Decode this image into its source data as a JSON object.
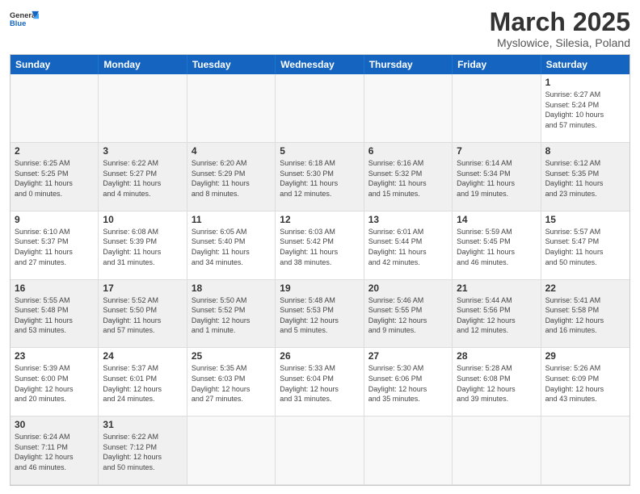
{
  "logo": {
    "text_general": "General",
    "text_blue": "Blue"
  },
  "title": "March 2025",
  "location": "Myslowice, Silesia, Poland",
  "days_of_week": [
    "Sunday",
    "Monday",
    "Tuesday",
    "Wednesday",
    "Thursday",
    "Friday",
    "Saturday"
  ],
  "weeks": [
    [
      {
        "day": "",
        "info": ""
      },
      {
        "day": "",
        "info": ""
      },
      {
        "day": "",
        "info": ""
      },
      {
        "day": "",
        "info": ""
      },
      {
        "day": "",
        "info": ""
      },
      {
        "day": "",
        "info": ""
      },
      {
        "day": "1",
        "info": "Sunrise: 6:27 AM\nSunset: 5:24 PM\nDaylight: 10 hours\nand 57 minutes."
      }
    ],
    [
      {
        "day": "2",
        "info": "Sunrise: 6:25 AM\nSunset: 5:25 PM\nDaylight: 11 hours\nand 0 minutes."
      },
      {
        "day": "3",
        "info": "Sunrise: 6:22 AM\nSunset: 5:27 PM\nDaylight: 11 hours\nand 4 minutes."
      },
      {
        "day": "4",
        "info": "Sunrise: 6:20 AM\nSunset: 5:29 PM\nDaylight: 11 hours\nand 8 minutes."
      },
      {
        "day": "5",
        "info": "Sunrise: 6:18 AM\nSunset: 5:30 PM\nDaylight: 11 hours\nand 12 minutes."
      },
      {
        "day": "6",
        "info": "Sunrise: 6:16 AM\nSunset: 5:32 PM\nDaylight: 11 hours\nand 15 minutes."
      },
      {
        "day": "7",
        "info": "Sunrise: 6:14 AM\nSunset: 5:34 PM\nDaylight: 11 hours\nand 19 minutes."
      },
      {
        "day": "8",
        "info": "Sunrise: 6:12 AM\nSunset: 5:35 PM\nDaylight: 11 hours\nand 23 minutes."
      }
    ],
    [
      {
        "day": "9",
        "info": "Sunrise: 6:10 AM\nSunset: 5:37 PM\nDaylight: 11 hours\nand 27 minutes."
      },
      {
        "day": "10",
        "info": "Sunrise: 6:08 AM\nSunset: 5:39 PM\nDaylight: 11 hours\nand 31 minutes."
      },
      {
        "day": "11",
        "info": "Sunrise: 6:05 AM\nSunset: 5:40 PM\nDaylight: 11 hours\nand 34 minutes."
      },
      {
        "day": "12",
        "info": "Sunrise: 6:03 AM\nSunset: 5:42 PM\nDaylight: 11 hours\nand 38 minutes."
      },
      {
        "day": "13",
        "info": "Sunrise: 6:01 AM\nSunset: 5:44 PM\nDaylight: 11 hours\nand 42 minutes."
      },
      {
        "day": "14",
        "info": "Sunrise: 5:59 AM\nSunset: 5:45 PM\nDaylight: 11 hours\nand 46 minutes."
      },
      {
        "day": "15",
        "info": "Sunrise: 5:57 AM\nSunset: 5:47 PM\nDaylight: 11 hours\nand 50 minutes."
      }
    ],
    [
      {
        "day": "16",
        "info": "Sunrise: 5:55 AM\nSunset: 5:48 PM\nDaylight: 11 hours\nand 53 minutes."
      },
      {
        "day": "17",
        "info": "Sunrise: 5:52 AM\nSunset: 5:50 PM\nDaylight: 11 hours\nand 57 minutes."
      },
      {
        "day": "18",
        "info": "Sunrise: 5:50 AM\nSunset: 5:52 PM\nDaylight: 12 hours\nand 1 minute."
      },
      {
        "day": "19",
        "info": "Sunrise: 5:48 AM\nSunset: 5:53 PM\nDaylight: 12 hours\nand 5 minutes."
      },
      {
        "day": "20",
        "info": "Sunrise: 5:46 AM\nSunset: 5:55 PM\nDaylight: 12 hours\nand 9 minutes."
      },
      {
        "day": "21",
        "info": "Sunrise: 5:44 AM\nSunset: 5:56 PM\nDaylight: 12 hours\nand 12 minutes."
      },
      {
        "day": "22",
        "info": "Sunrise: 5:41 AM\nSunset: 5:58 PM\nDaylight: 12 hours\nand 16 minutes."
      }
    ],
    [
      {
        "day": "23",
        "info": "Sunrise: 5:39 AM\nSunset: 6:00 PM\nDaylight: 12 hours\nand 20 minutes."
      },
      {
        "day": "24",
        "info": "Sunrise: 5:37 AM\nSunset: 6:01 PM\nDaylight: 12 hours\nand 24 minutes."
      },
      {
        "day": "25",
        "info": "Sunrise: 5:35 AM\nSunset: 6:03 PM\nDaylight: 12 hours\nand 27 minutes."
      },
      {
        "day": "26",
        "info": "Sunrise: 5:33 AM\nSunset: 6:04 PM\nDaylight: 12 hours\nand 31 minutes."
      },
      {
        "day": "27",
        "info": "Sunrise: 5:30 AM\nSunset: 6:06 PM\nDaylight: 12 hours\nand 35 minutes."
      },
      {
        "day": "28",
        "info": "Sunrise: 5:28 AM\nSunset: 6:08 PM\nDaylight: 12 hours\nand 39 minutes."
      },
      {
        "day": "29",
        "info": "Sunrise: 5:26 AM\nSunset: 6:09 PM\nDaylight: 12 hours\nand 43 minutes."
      }
    ],
    [
      {
        "day": "30",
        "info": "Sunrise: 6:24 AM\nSunset: 7:11 PM\nDaylight: 12 hours\nand 46 minutes."
      },
      {
        "day": "31",
        "info": "Sunrise: 6:22 AM\nSunset: 7:12 PM\nDaylight: 12 hours\nand 50 minutes."
      },
      {
        "day": "",
        "info": ""
      },
      {
        "day": "",
        "info": ""
      },
      {
        "day": "",
        "info": ""
      },
      {
        "day": "",
        "info": ""
      },
      {
        "day": "",
        "info": ""
      }
    ]
  ]
}
